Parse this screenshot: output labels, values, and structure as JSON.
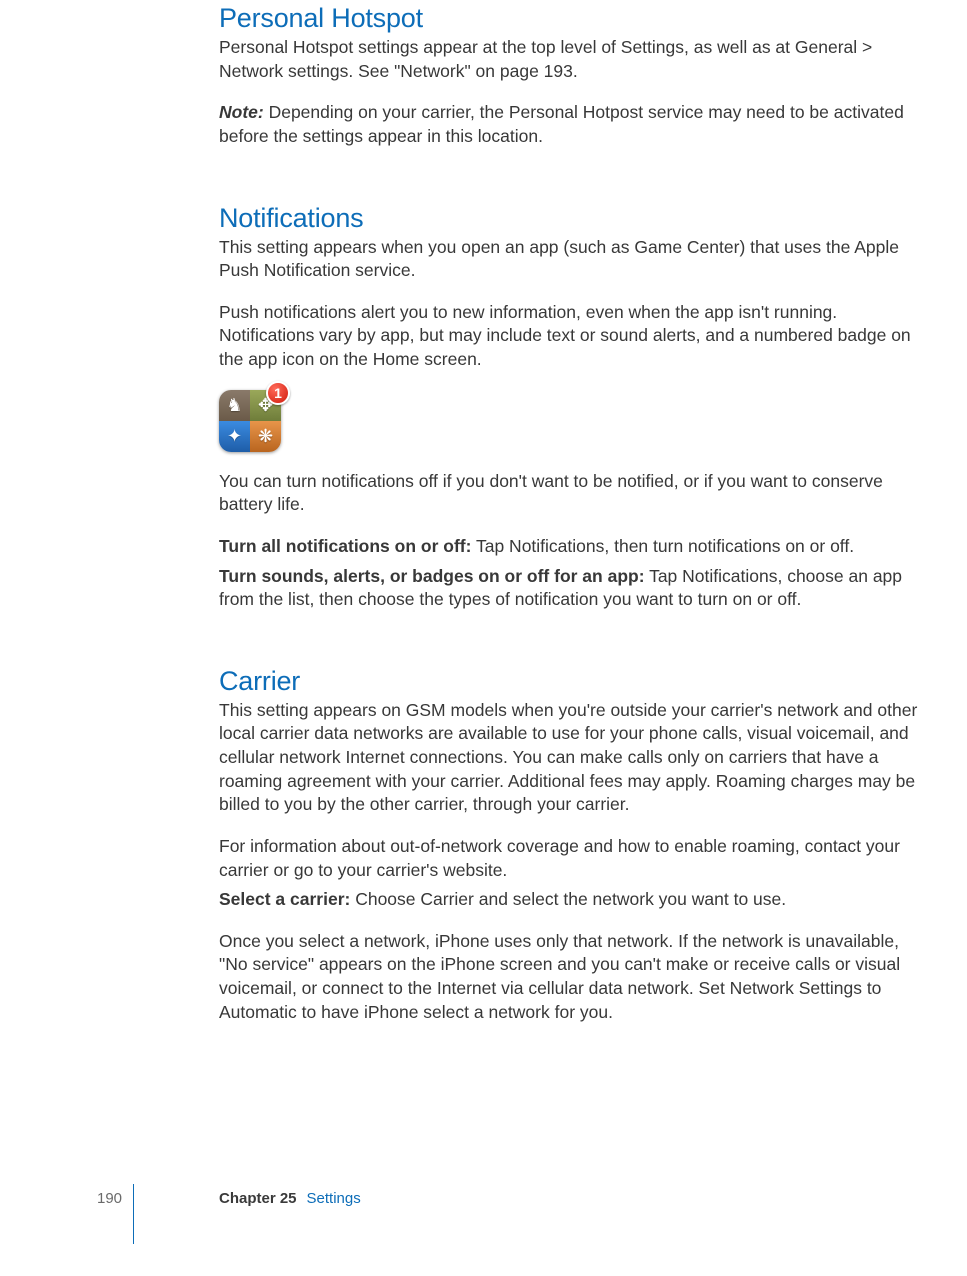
{
  "sections": {
    "personal_hotspot": {
      "heading": "Personal Hotspot",
      "p1": "Personal Hotspot settings appear at the top level of Settings, as well as at General > Network settings. See \"Network\" on page 193.",
      "note_label": "Note:",
      "note_body": "  Depending on your carrier, the Personal Hotpost service may need to be activated before the settings appear in this location."
    },
    "notifications": {
      "heading": "Notifications",
      "p1": "This setting appears when you open an app (such as Game Center) that uses the Apple Push Notification service.",
      "p2": "Push notifications alert you to new information, even when the app isn't running. Notifications vary by app, but may include text or sound alerts, and a numbered badge on the app icon on the Home screen.",
      "badge_count": "1",
      "p3": "You can turn notifications off if you don't want to be notified, or if you want to conserve battery life.",
      "turn_all_label": "Turn all notifications on or off:",
      "turn_all_body": "  Tap Notifications, then turn notifications on or off.",
      "turn_sounds_label": "Turn sounds, alerts, or badges on or off for an app:",
      "turn_sounds_body": "  Tap Notifications, choose an app from the list, then choose the types of notification you want to turn on or off."
    },
    "carrier": {
      "heading": "Carrier",
      "p1": "This setting appears on GSM models when you're outside your carrier's network and other local carrier data networks are available to use for your phone calls, visual voicemail, and cellular network Internet connections. You can make calls only on carriers that have a roaming agreement with your carrier. Additional fees may apply. Roaming charges may be billed to you by the other carrier, through your carrier.",
      "p2": "For information about out-of-network coverage and how to enable roaming, contact your carrier or go to your carrier's website.",
      "select_label": "Select a carrier:",
      "select_body": "  Choose Carrier and select the network you want to use.",
      "p3": "Once you select a network, iPhone uses only that network. If the network is unavailable, \"No service\" appears on the iPhone screen and you can't make or receive calls or visual voicemail, or connect to the Internet via cellular data network. Set Network Settings to Automatic to have iPhone select a network for you."
    }
  },
  "footer": {
    "page_number": "190",
    "chapter_label": "Chapter 25",
    "chapter_title": "Settings"
  }
}
